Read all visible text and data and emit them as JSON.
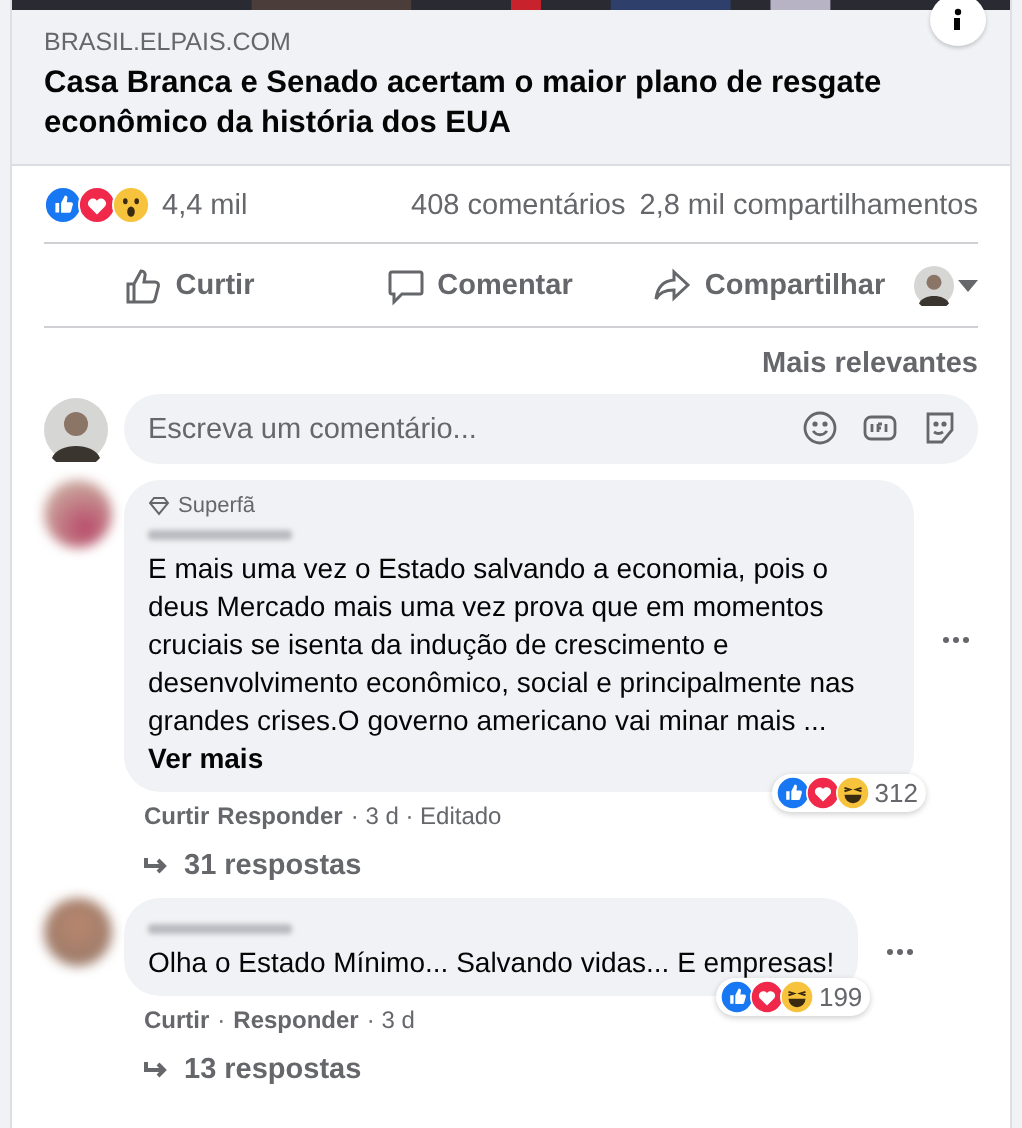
{
  "link_preview": {
    "domain": "BRASIL.ELPAIS.COM",
    "title": "Casa Branca e Senado acertam o maior plano de resgate econômico da história dos EUA"
  },
  "stats": {
    "reactions": [
      {
        "kind": "like"
      },
      {
        "kind": "love"
      },
      {
        "kind": "wow"
      }
    ],
    "reaction_count": "4,4 mil",
    "comments": "408 comentários",
    "shares": "2,8 mil compartilhamentos"
  },
  "actions": [
    {
      "kind": "like",
      "label": "Curtir"
    },
    {
      "kind": "comment",
      "label": "Comentar"
    },
    {
      "kind": "share",
      "label": "Compartilhar"
    }
  ],
  "sort": "Mais relevantes",
  "composer": {
    "placeholder": "Escreva um comentário..."
  },
  "comments": [
    {
      "badge": "Superfã",
      "text": "E mais uma vez o Estado salvando a economia, pois o deus Mercado mais uma vez prova que em momentos cruciais se isenta da indução de crescimento e desenvolvimento econômico, social e principalmente nas grandes crises.O governo americano vai minar mais ...",
      "see_more": "Ver mais",
      "meta": [
        {
          "kind": "link",
          "text": "Curtir"
        },
        {
          "kind": "link",
          "text": "Responder"
        },
        {
          "kind": "text",
          "text": "· 3 d · Editado"
        }
      ],
      "reactions": [
        {
          "kind": "like"
        },
        {
          "kind": "love"
        },
        {
          "kind": "haha"
        }
      ],
      "reaction_count": "312",
      "replies": "31 respostas"
    },
    {
      "text": "Olha o Estado Mínimo... Salvando vidas... E empresas!",
      "meta": [
        {
          "kind": "link",
          "text": "Curtir"
        },
        {
          "kind": "text",
          "text": "·"
        },
        {
          "kind": "link",
          "text": "Responder"
        },
        {
          "kind": "text",
          "text": "· 3 d"
        }
      ],
      "reactions": [
        {
          "kind": "like"
        },
        {
          "kind": "love"
        },
        {
          "kind": "haha"
        }
      ],
      "reaction_count": "199",
      "replies": "13 respostas"
    }
  ]
}
